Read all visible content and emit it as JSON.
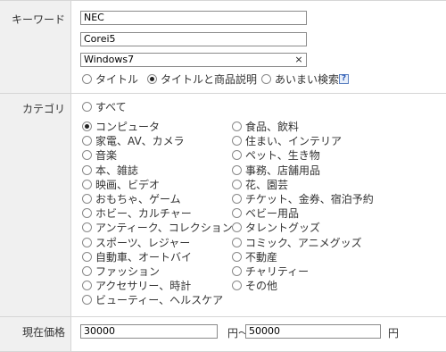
{
  "keyword": {
    "label": "キーワード",
    "inputs": [
      "NEC",
      "Corei5",
      "Windows7"
    ],
    "clear_glyph": "×",
    "scope_options": [
      {
        "label": "タイトル",
        "checked": false
      },
      {
        "label": "タイトルと商品説明",
        "checked": true
      },
      {
        "label": "あいまい検索",
        "checked": false
      }
    ],
    "help_glyph": "?"
  },
  "category": {
    "label": "カテゴリ",
    "all_option": {
      "label": "すべて",
      "checked": false
    },
    "left_column": [
      {
        "label": "コンピュータ",
        "checked": true
      },
      {
        "label": "家電、AV、カメラ",
        "checked": false
      },
      {
        "label": "音楽",
        "checked": false
      },
      {
        "label": "本、雑誌",
        "checked": false
      },
      {
        "label": "映画、ビデオ",
        "checked": false
      },
      {
        "label": "おもちゃ、ゲーム",
        "checked": false
      },
      {
        "label": "ホビー、カルチャー",
        "checked": false
      },
      {
        "label": "アンティーク、コレクション",
        "checked": false
      },
      {
        "label": "スポーツ、レジャー",
        "checked": false
      },
      {
        "label": "自動車、オートバイ",
        "checked": false
      },
      {
        "label": "ファッション",
        "checked": false
      },
      {
        "label": "アクセサリー、時計",
        "checked": false
      },
      {
        "label": "ビューティー、ヘルスケア",
        "checked": false
      }
    ],
    "right_column": [
      {
        "label": "食品、飲料",
        "checked": false
      },
      {
        "label": "住まい、インテリア",
        "checked": false
      },
      {
        "label": "ペット、生き物",
        "checked": false
      },
      {
        "label": "事務、店舗用品",
        "checked": false
      },
      {
        "label": "花、園芸",
        "checked": false
      },
      {
        "label": "チケット、金券、宿泊予約",
        "checked": false
      },
      {
        "label": "ベビー用品",
        "checked": false
      },
      {
        "label": "タレントグッズ",
        "checked": false
      },
      {
        "label": "コミック、アニメグッズ",
        "checked": false
      },
      {
        "label": "不動産",
        "checked": false
      },
      {
        "label": "チャリティー",
        "checked": false
      },
      {
        "label": "その他",
        "checked": false
      }
    ]
  },
  "price": {
    "label": "現在価格",
    "min_value": "30000",
    "range_separator": "円〜",
    "max_value": "50000",
    "unit": "円"
  }
}
